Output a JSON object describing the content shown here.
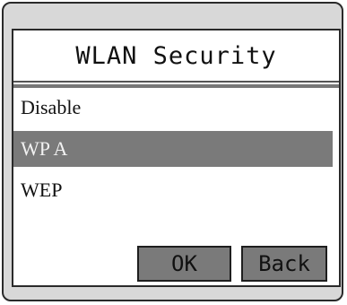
{
  "title": "WLAN Security",
  "menu": {
    "items": [
      {
        "label": "Disable",
        "selected": false
      },
      {
        "label": "WP A",
        "selected": true
      },
      {
        "label": "WEP",
        "selected": false
      }
    ]
  },
  "buttons": {
    "ok_label": "OK",
    "back_label": "Back"
  },
  "colors": {
    "device_bg": "#d8d8d8",
    "screen_bg": "#ffffff",
    "selection_bg": "#7a7a7a",
    "button_bg": "#7a7a7a",
    "text": "#111111"
  }
}
